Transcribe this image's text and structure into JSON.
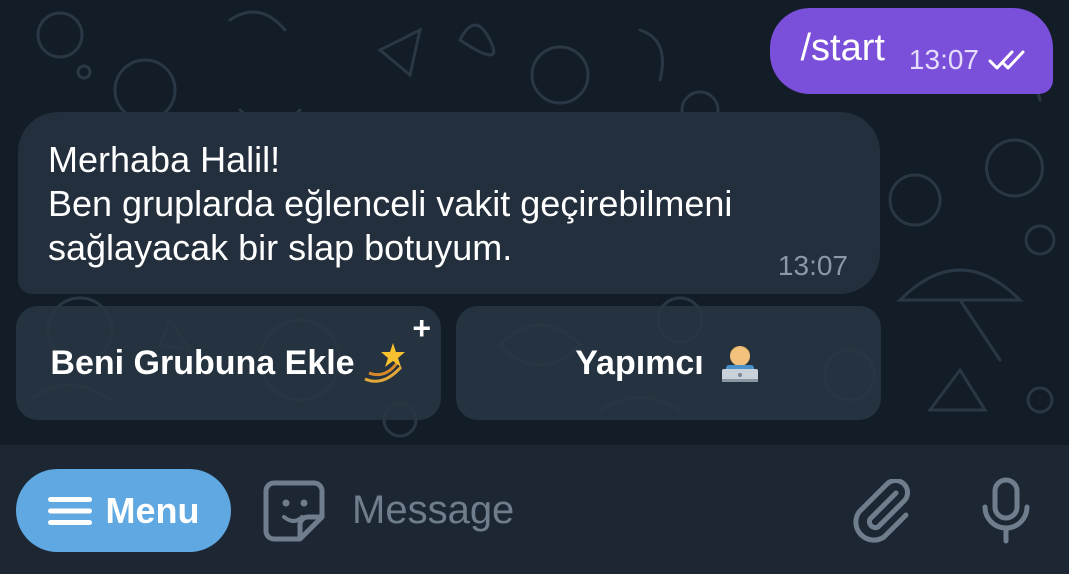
{
  "outgoing": {
    "text": "/start",
    "time": "13:07",
    "status": "read-double-check-icon"
  },
  "incoming": {
    "lines": [
      "Merhaba Halil!",
      "Ben gruplarda eğlenceli vakit geçirebilmeni",
      "sağlayacak bir slap botuyum."
    ],
    "time": "13:07"
  },
  "keyboard": {
    "buttons": [
      {
        "label": "Beni Grubuna Ekle",
        "emoji": "dizzy-star-emoji",
        "corner": "+"
      },
      {
        "label": "Yapımcı",
        "emoji": "technologist-emoji"
      }
    ]
  },
  "composer": {
    "menu_label": "Menu",
    "placeholder": "Message",
    "icons": [
      "menu-icon",
      "sticker-icon",
      "attach-icon",
      "mic-icon"
    ]
  },
  "colors": {
    "chat_bg": "#131d28",
    "outgoing_bubble": "#7a4fd9",
    "incoming_bubble": "#232f3c",
    "menu_button": "#5fa8e1",
    "composer_bg": "#1c2733"
  }
}
